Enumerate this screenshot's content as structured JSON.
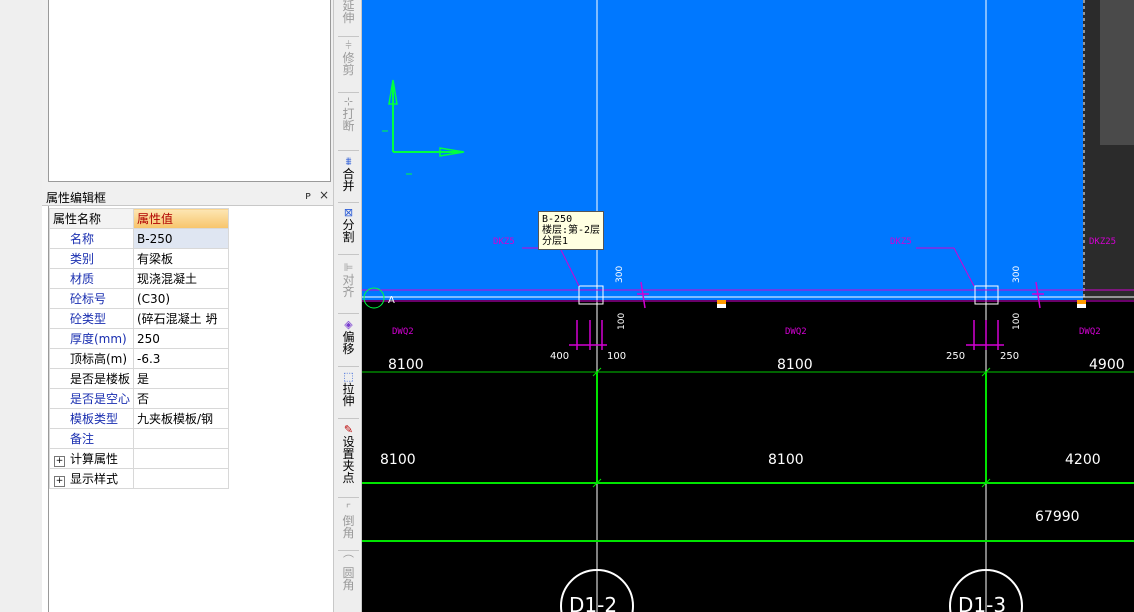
{
  "property_panel": {
    "title": "属性编辑框",
    "pin": "ᴘ",
    "close": "×",
    "col_name": "属性名称",
    "col_value": "属性值",
    "rows": [
      {
        "name": "名称",
        "value": "B-250"
      },
      {
        "name": "类别",
        "value": "有梁板"
      },
      {
        "name": "材质",
        "value": "现浇混凝土"
      },
      {
        "name": "砼标号",
        "value": "(C30)"
      },
      {
        "name": "砼类型",
        "value": "(碎石混凝土 坍"
      },
      {
        "name": "厚度(mm)",
        "value": "250"
      },
      {
        "name": "顶标高(m)",
        "value": "-6.3"
      },
      {
        "name": "是否是楼板",
        "value": "是"
      },
      {
        "name": "是否是空心",
        "value": "否"
      },
      {
        "name": "模板类型",
        "value": "九夹板模板/钢"
      },
      {
        "name": "备注",
        "value": ""
      }
    ],
    "groups": [
      {
        "expander": "+",
        "name": "计算属性"
      },
      {
        "expander": "+",
        "name": "显示样式"
      }
    ]
  },
  "toolbar": {
    "items": [
      {
        "icon": "⟞",
        "label": "延伸",
        "enabled": false
      },
      {
        "icon": "⫩",
        "label": "修剪",
        "enabled": false
      },
      {
        "icon": "⊹",
        "label": "打断",
        "enabled": false
      },
      {
        "icon": "⩩",
        "label": "合并",
        "enabled": true
      },
      {
        "icon": "⊠",
        "label": "分割",
        "enabled": true
      },
      {
        "icon": "⊫",
        "label": "对齐",
        "enabled": false
      },
      {
        "icon": "◈",
        "label": "偏移",
        "enabled": true
      },
      {
        "icon": "⬚",
        "label": "拉伸",
        "enabled": true
      },
      {
        "icon": "✎",
        "label": "设置夹点",
        "enabled": true
      },
      {
        "icon": "⌜",
        "label": "倒角",
        "enabled": false
      },
      {
        "icon": "⌒",
        "label": "圆角",
        "enabled": false
      }
    ]
  },
  "cad": {
    "tooltip": {
      "line1": "B-250",
      "line2": "楼层:第-2层",
      "line3": "分层1"
    },
    "axis_marker": "A",
    "labels": {
      "dkz_left": "DKZ5",
      "dkz_right": "DKZ5",
      "dkz_far": "DKZ25",
      "dwq_left": "DWQ2",
      "dwq_mid": "DWQ2",
      "dwq_right": "DWQ2",
      "dim_300_a": "300",
      "dim_100_a": "100",
      "dim_300_b": "300",
      "dim_100_b": "100",
      "dim_400": "400",
      "dim_100_c": "100",
      "dim_250_a": "250",
      "dim_250_b": "250",
      "span_top_1": "8100",
      "span_top_2": "8100",
      "span_top_3": "4900",
      "span_mid_1": "8100",
      "span_mid_2": "8100",
      "span_mid_3": "4200",
      "total": "67990",
      "axis_bubble_1": "D1-2",
      "axis_bubble_2": "D1-3"
    },
    "colors": {
      "canvas": "#000000",
      "slab_fill": "#0078ff",
      "dimension": "#00e400",
      "magenta": "#d200d2",
      "gridline": "#ffffff"
    }
  }
}
